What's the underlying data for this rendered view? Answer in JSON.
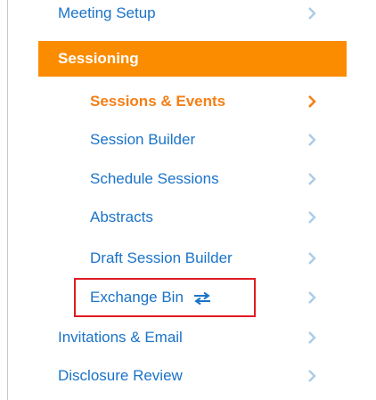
{
  "nav": {
    "meeting_setup": "Meeting Setup",
    "section": "Sessioning",
    "items": [
      {
        "label": "Sessions & Events",
        "active": true
      },
      {
        "label": "Session Builder"
      },
      {
        "label": "Schedule Sessions"
      },
      {
        "label": "Abstracts"
      },
      {
        "label": "Draft Session Builder"
      },
      {
        "label": "Exchange Bin",
        "icon": "swap-arrows-icon",
        "highlighted": true
      }
    ],
    "invitations": "Invitations & Email",
    "disclosure": "Disclosure Review"
  },
  "colors": {
    "link": "#1a73c8",
    "accent": "#fb8c00",
    "active_text": "#f57f17",
    "chevron": "#a9cbe8",
    "chevron_active": "#f57f17",
    "highlight_border": "#e01b24"
  }
}
